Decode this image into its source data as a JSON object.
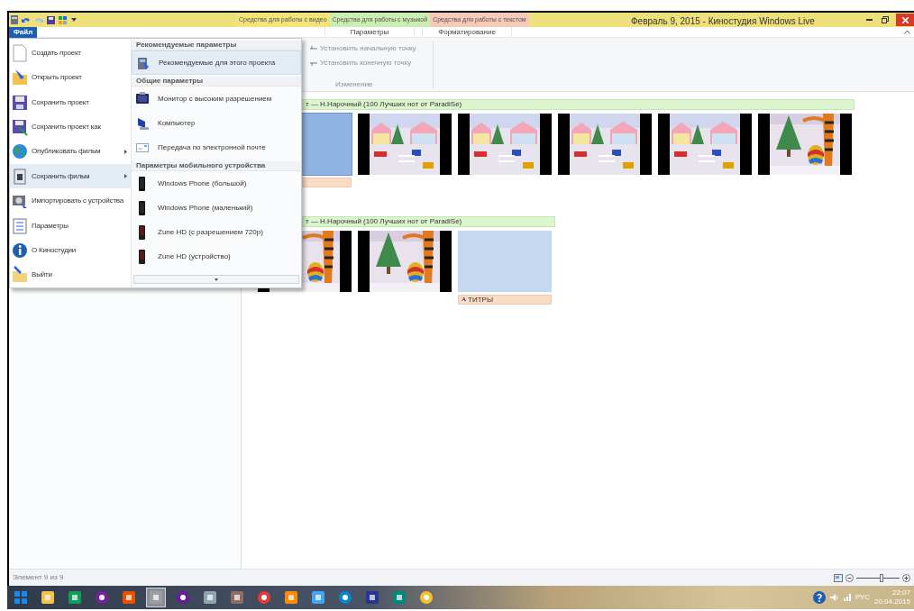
{
  "window": {
    "title": "Февраль 9, 2015 - Киностудия Windows Live"
  },
  "context_tabs": [
    {
      "label": "Средства для работы с видео",
      "color": "#f2e47a"
    },
    {
      "label": "Средства для работы с музыкой",
      "color": "#c9eeb0"
    },
    {
      "label": "Средства для работы с текстом",
      "color": "#f6c9b8"
    }
  ],
  "ribbon_tabs": [
    {
      "label": "Файл",
      "selected": true
    },
    {
      "label": "Параметры",
      "selected": false
    },
    {
      "label": "Форматирование",
      "selected": false
    }
  ],
  "ribbon": {
    "commands": [
      "Установить начальную точку",
      "Установить конечную точку"
    ],
    "group": "Изменение"
  },
  "file_menu": {
    "items": [
      {
        "label": "Создать проект",
        "kind": "new",
        "submenu": false,
        "selected": false
      },
      {
        "label": "Открыть проект",
        "kind": "open",
        "submenu": false,
        "selected": false
      },
      {
        "label": "Сохранить проект",
        "kind": "save",
        "submenu": false,
        "selected": false
      },
      {
        "label": "Сохранить проект как",
        "kind": "saveas",
        "submenu": false,
        "selected": false
      },
      {
        "label": "Опубликовать фильм",
        "kind": "globe",
        "submenu": true,
        "selected": false
      },
      {
        "label": "Сохранить фильм",
        "kind": "film",
        "submenu": true,
        "selected": true
      },
      {
        "label": "Импортировать с устройства",
        "kind": "camera",
        "submenu": false,
        "selected": false
      },
      {
        "label": "Параметры",
        "kind": "options",
        "submenu": false,
        "selected": false
      },
      {
        "label": "О Киностудии",
        "kind": "info",
        "submenu": false,
        "selected": false
      },
      {
        "label": "Выйти",
        "kind": "exit",
        "submenu": false,
        "selected": false
      }
    ],
    "submenu": [
      {
        "kind": "header",
        "label": "Рекомендуемые параметры"
      },
      {
        "kind": "recommended",
        "label": "Рекомендуемые для этого проекта",
        "selected": true
      },
      {
        "kind": "header",
        "label": "Общие параметры"
      },
      {
        "kind": "monitor",
        "label": "Монитор с высоким разрешением",
        "selected": false
      },
      {
        "kind": "computer",
        "label": "Компьютер",
        "selected": false
      },
      {
        "kind": "mail",
        "label": "Передача по электронной почте",
        "selected": false
      },
      {
        "kind": "header",
        "label": "Параметры мобильного устройства"
      },
      {
        "kind": "phone",
        "label": "Windows Phone (большой)",
        "selected": false
      },
      {
        "kind": "phone",
        "label": "Windows Phone (маленький)",
        "selected": false
      },
      {
        "kind": "zune",
        "label": "Zune HD (с разрешением 720p)",
        "selected": false
      },
      {
        "kind": "zune",
        "label": "Zune HD (устройство)",
        "selected": false
      }
    ]
  },
  "storyboard": {
    "rows": [
      {
        "music_caption": "т — Н.Нарочный (100 Лучших нот от ParadiSe)",
        "wide": true,
        "clips": [
          {
            "kind": "title",
            "selected": true
          },
          {
            "kind": "picture"
          },
          {
            "kind": "picture"
          },
          {
            "kind": "picture"
          },
          {
            "kind": "picture"
          },
          {
            "kind": "picture"
          }
        ]
      },
      {
        "music_caption": "т — Н.Нарочный (100 Лучших нот от ParadiSe)",
        "wide": false,
        "clips": [
          {
            "kind": "picture"
          },
          {
            "kind": "picture"
          },
          {
            "kind": "title",
            "selected": false,
            "glyph": "A",
            "caption": "ТИТРЫ"
          }
        ]
      }
    ]
  },
  "status_bar": {
    "text": "Элемент 9 из 9",
    "zoom": {
      "level": 0.6
    }
  },
  "taskbar": {
    "apps": [
      {
        "active": false
      },
      {
        "active": false
      },
      {
        "active": false
      },
      {
        "active": false
      },
      {
        "active": false
      },
      {
        "active": true
      },
      {
        "active": false
      },
      {
        "active": false
      },
      {
        "active": false
      },
      {
        "active": false
      },
      {
        "active": false
      },
      {
        "active": false
      },
      {
        "active": false
      },
      {
        "active": false
      },
      {
        "active": false
      },
      {
        "active": false
      }
    ],
    "language": "РУС",
    "time": "22:07",
    "date": "20.04.2015"
  }
}
